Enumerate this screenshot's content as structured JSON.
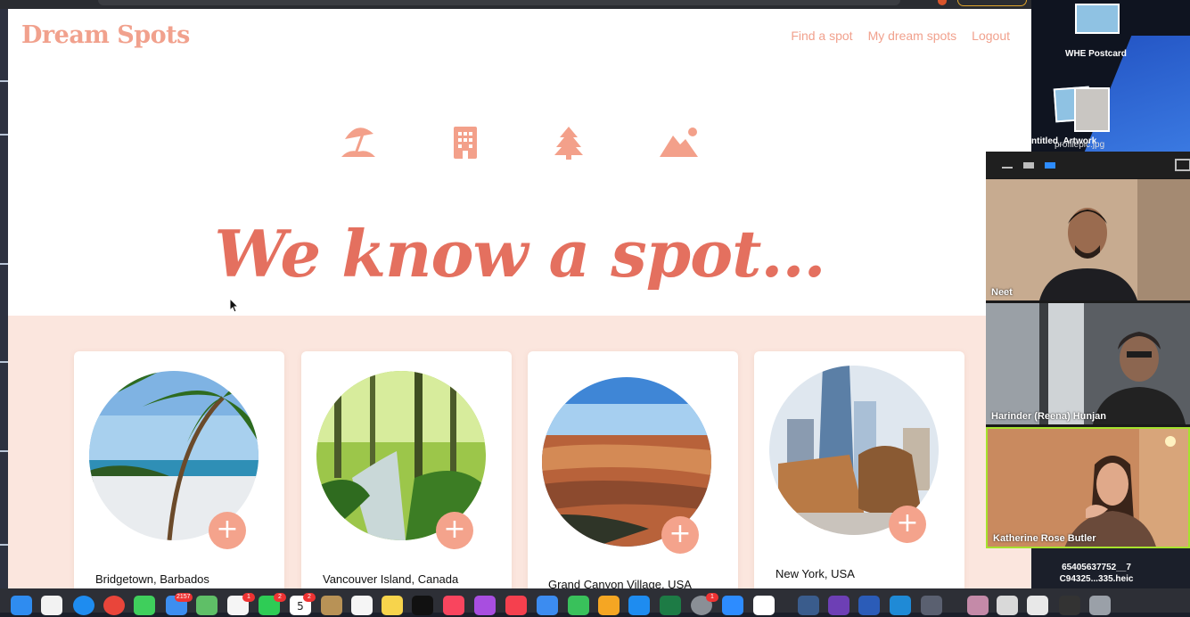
{
  "site": {
    "brand": "Dream Spots",
    "nav": [
      "Find a spot",
      "My dream spots",
      "Logout"
    ],
    "hero_title": "We know a spot...",
    "hero_icons": [
      "beach-umbrella-icon",
      "building-icon",
      "tree-icon",
      "mountain-icon"
    ],
    "accent_color": "#e4705f",
    "brand_color": "#f1a18d",
    "cards": [
      {
        "label": "Bridgetown, Barbados",
        "image": "palm-beach-image",
        "action": "+"
      },
      {
        "label": "Vancouver Island, Canada",
        "image": "forest-stream-image",
        "action": "+"
      },
      {
        "label": "Grand Canyon Village, USA",
        "image": "grand-canyon-image",
        "action": "+"
      },
      {
        "label": "New York, USA",
        "image": "new-york-vessel-image",
        "action": "+"
      }
    ]
  },
  "desktop": {
    "files": [
      "WHE Postcard",
      "ntitled_Artwork",
      "profilepic.jpg"
    ],
    "bottom_file": [
      "65405637752__7",
      "C94325...335.heic"
    ]
  },
  "zoom": {
    "participants": [
      "Neet",
      "Harinder (Reena) Hunjan",
      "Katherine Rose Butler"
    ],
    "active_speaker": "Katherine Rose Butler"
  },
  "dock": {
    "badges": [
      "2157",
      "1",
      "2",
      "2",
      "1"
    ],
    "calendar_date": "5"
  }
}
